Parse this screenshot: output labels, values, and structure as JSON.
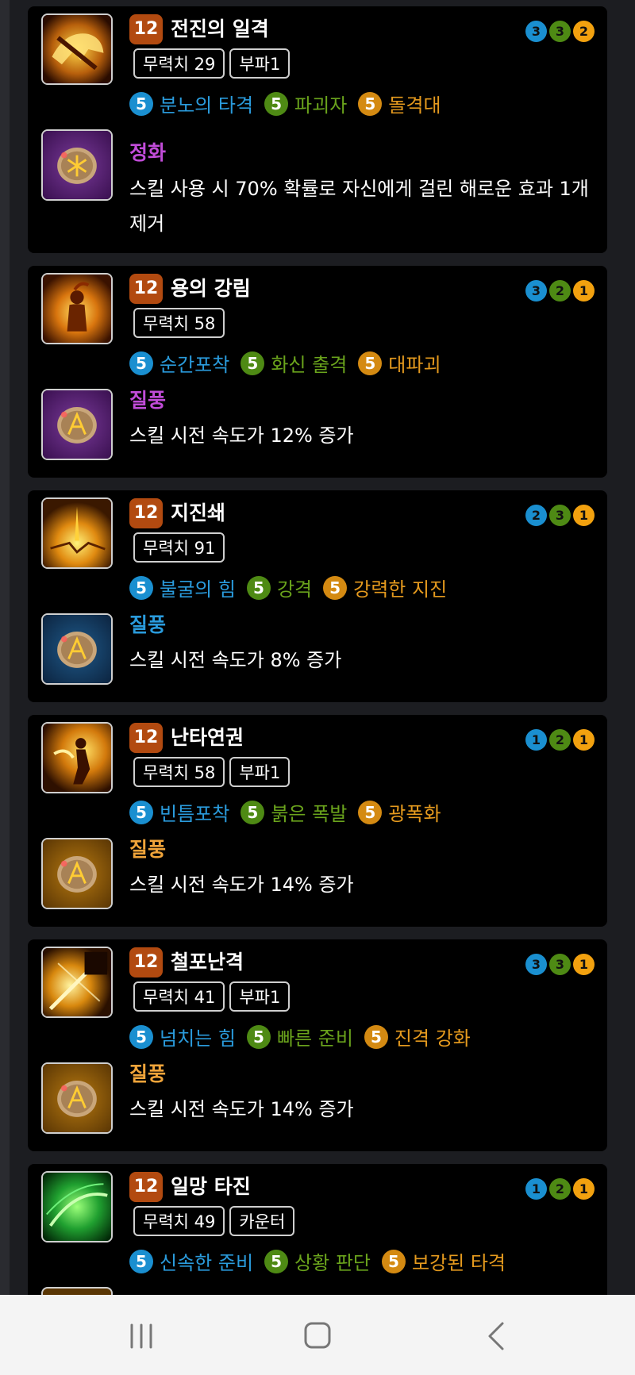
{
  "colors": {
    "card_bg": "#000000",
    "level_badge": "#b24a10",
    "blue": "#1a8fd0",
    "green": "#4e8a14",
    "orange": "#d48a12",
    "rune_purple": "#c14cd8",
    "rune_orange": "#f0a43a"
  },
  "cards": [
    {
      "level": "12",
      "name": "전진의 일격",
      "tags": [
        "무력치 29",
        "부파1"
      ],
      "tripods": [
        {
          "level": "5",
          "name": "분노의 타격"
        },
        {
          "level": "5",
          "name": "파괴자"
        },
        {
          "level": "5",
          "name": "돌격대"
        }
      ],
      "gems": [
        "3",
        "3",
        "2"
      ],
      "rune": {
        "name": "정화",
        "grade": "purple",
        "desc": "스킬 사용 시 70% 확률로 자신에게 걸린 해로운 효과 1개 제거"
      }
    },
    {
      "level": "12",
      "name": "용의 강림",
      "tags": [
        "무력치 58"
      ],
      "tripods": [
        {
          "level": "5",
          "name": "순간포착"
        },
        {
          "level": "5",
          "name": "화신 출격"
        },
        {
          "level": "5",
          "name": "대파괴"
        }
      ],
      "gems": [
        "3",
        "2",
        "1"
      ],
      "rune": {
        "name": "질풍",
        "grade": "purple",
        "desc": "스킬 시전 속도가 12% 증가"
      }
    },
    {
      "level": "12",
      "name": "지진쇄",
      "tags": [
        "무력치 91"
      ],
      "tripods": [
        {
          "level": "5",
          "name": "불굴의 힘"
        },
        {
          "level": "5",
          "name": "강격"
        },
        {
          "level": "5",
          "name": "강력한 지진"
        }
      ],
      "gems": [
        "2",
        "3",
        "1"
      ],
      "rune": {
        "name": "질풍",
        "grade": "blue",
        "desc": "스킬 시전 속도가 8% 증가"
      }
    },
    {
      "level": "12",
      "name": "난타연권",
      "tags": [
        "무력치 58",
        "부파1"
      ],
      "tripods": [
        {
          "level": "5",
          "name": "빈틈포착"
        },
        {
          "level": "5",
          "name": "붉은 폭발"
        },
        {
          "level": "5",
          "name": "광폭화"
        }
      ],
      "gems": [
        "1",
        "2",
        "1"
      ],
      "rune": {
        "name": "질풍",
        "grade": "orange",
        "desc": "스킬 시전 속도가 14% 증가"
      }
    },
    {
      "level": "12",
      "name": "철포난격",
      "tags": [
        "무력치 41",
        "부파1"
      ],
      "tripods": [
        {
          "level": "5",
          "name": "넘치는 힘"
        },
        {
          "level": "5",
          "name": "빠른 준비"
        },
        {
          "level": "5",
          "name": "진격 강화"
        }
      ],
      "gems": [
        "3",
        "3",
        "1"
      ],
      "rune": {
        "name": "질풍",
        "grade": "orange",
        "desc": "스킬 시전 속도가 14% 증가"
      }
    },
    {
      "level": "12",
      "name": "일망 타진",
      "tags": [
        "무력치 49",
        "카운터"
      ],
      "tripods": [
        {
          "level": "5",
          "name": "신속한 준비"
        },
        {
          "level": "5",
          "name": "상황 판단"
        },
        {
          "level": "5",
          "name": "보강된 타격"
        }
      ],
      "gems": [
        "1",
        "2",
        "1"
      ],
      "rune": null
    }
  ],
  "navbar": {
    "recents_icon": "recent-apps-icon",
    "home_icon": "home-icon",
    "back_icon": "back-icon"
  }
}
